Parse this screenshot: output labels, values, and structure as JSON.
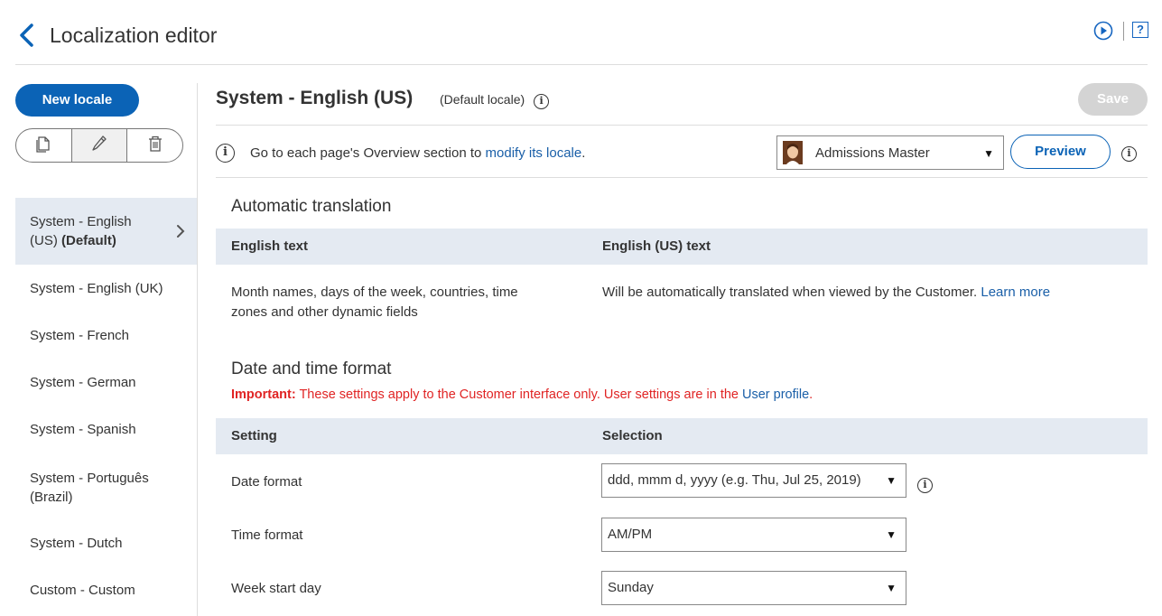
{
  "header": {
    "title": "Localization editor"
  },
  "sidebar": {
    "new_locale_label": "New locale",
    "icons": [
      "copy-icon",
      "pencil-icon",
      "trash-icon"
    ],
    "locales": [
      {
        "line1": "System - English",
        "line2": "(US)",
        "bold": "(Default)",
        "selected": true
      },
      {
        "line1": "System - English (UK)"
      },
      {
        "line1": "System - French"
      },
      {
        "line1": "System - German"
      },
      {
        "line1": "System - Spanish"
      },
      {
        "line1": "System - Português",
        "line2": "(Brazil)"
      },
      {
        "line1": "System - Dutch"
      },
      {
        "line1": "Custom - Custom"
      }
    ]
  },
  "main": {
    "title": "System - English (US)",
    "subtitle": "(Default locale)",
    "save_label": "Save",
    "notice_text": "Go to each page's Overview section to ",
    "notice_link": "modify its locale",
    "notice_end": ".",
    "persona": "Admissions Master",
    "preview_label": "Preview",
    "auto_translation": {
      "heading": "Automatic translation",
      "col1": "English text",
      "col2": "English (US) text",
      "row_left_1": "Month names, days of the week, countries, time",
      "row_left_2": "zones and other dynamic fields",
      "row_right": "Will be automatically translated when viewed by the Customer. ",
      "learn_more": "Learn more"
    },
    "date_time": {
      "heading": "Date and time format",
      "important_label": "Important:",
      "important_text": " These settings apply to the Customer interface only. User settings are in the ",
      "user_profile_link": "User profile",
      "important_end": ".",
      "col1": "Setting",
      "col2": "Selection",
      "rows": [
        {
          "label": "Date format",
          "value": "ddd, mmm d, yyyy (e.g. Thu, Jul 25, 2019)"
        },
        {
          "label": "Time format",
          "value": "AM/PM"
        },
        {
          "label": "Week start day",
          "value": "Sunday"
        }
      ]
    }
  },
  "colors": {
    "accent": "#0b63b6",
    "link": "#1a5fa8",
    "important": "#e02424",
    "table_header": "#e4eaf2"
  }
}
